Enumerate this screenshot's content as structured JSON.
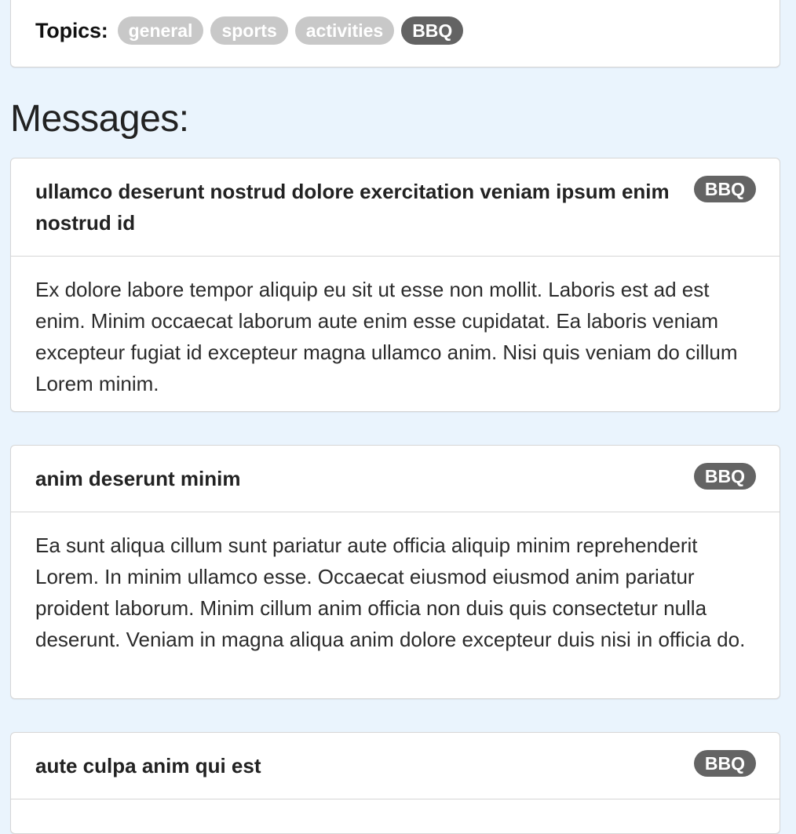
{
  "topics": {
    "label": "Topics:",
    "tags": [
      {
        "label": "general",
        "active": false
      },
      {
        "label": "sports",
        "active": false
      },
      {
        "label": "activities",
        "active": false
      },
      {
        "label": "BBQ",
        "active": true
      }
    ]
  },
  "messages_heading": "Messages:",
  "messages": [
    {
      "title": "ullamco deserunt nostrud dolore exercitation veniam ipsum enim nostrud id",
      "tag": "BBQ",
      "body": "Ex dolore labore tempor aliquip eu sit ut esse non mollit. Laboris est ad est enim. Minim occaecat laborum aute enim esse cupidatat. Ea laboris veniam excepteur fugiat id excepteur magna ullamco anim. Nisi quis veniam do cillum Lorem minim."
    },
    {
      "title": "anim deserunt minim",
      "tag": "BBQ",
      "body": "Ea sunt aliqua cillum sunt pariatur aute officia aliquip minim reprehenderit Lorem. In minim ullamco esse. Occaecat eiusmod eiusmod anim pariatur proident laborum. Minim cillum anim officia non duis quis consectetur nulla deserunt. Veniam in magna aliqua anim dolore excepteur duis nisi in officia do."
    },
    {
      "title": "aute culpa anim qui est",
      "tag": "BBQ",
      "body": ""
    }
  ],
  "colors": {
    "page_background": "#eaf4fd",
    "tag_inactive": "#c8c8c8",
    "tag_active": "#636363",
    "card_border": "#d6d6d6"
  }
}
